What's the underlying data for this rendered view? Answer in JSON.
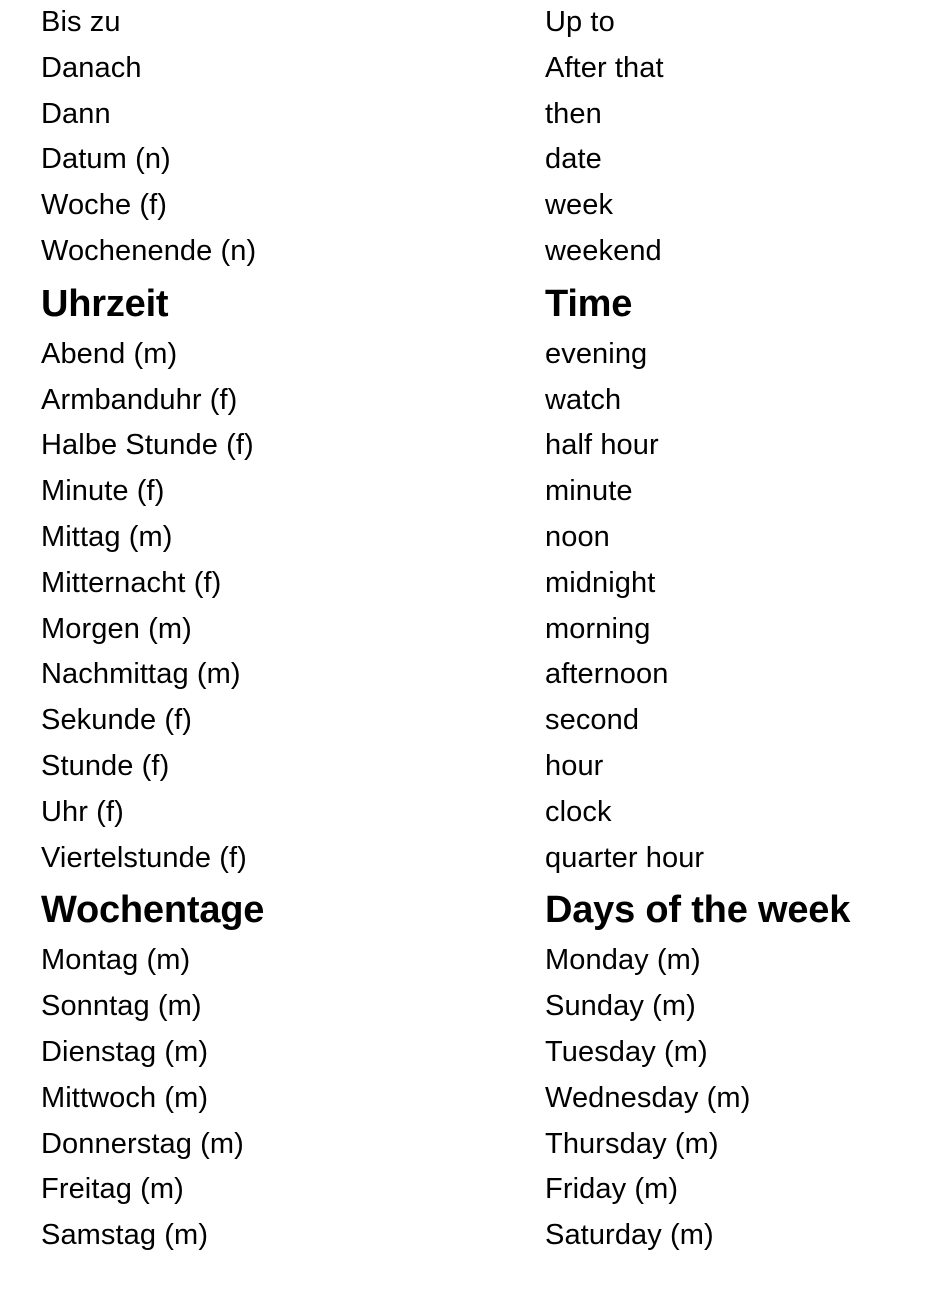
{
  "document": {
    "type": "bilingual-glossary",
    "source_language": "German",
    "target_language": "English",
    "background_color": "#ffffff",
    "text_color": "#000000"
  },
  "rows": [
    {
      "kind": "entry",
      "source": "Bis zu",
      "target": "Up to"
    },
    {
      "kind": "entry",
      "source": "Danach",
      "target": "After that"
    },
    {
      "kind": "entry",
      "source": "Dann",
      "target": "then"
    },
    {
      "kind": "entry",
      "source": "Datum (n)",
      "target": "date"
    },
    {
      "kind": "entry",
      "source": "Woche (f)",
      "target": "week"
    },
    {
      "kind": "entry",
      "source": "Wochenende (n)",
      "target": "weekend"
    },
    {
      "kind": "heading",
      "source": "Uhrzeit",
      "target": "Time"
    },
    {
      "kind": "entry",
      "source": "Abend (m)",
      "target": "evening"
    },
    {
      "kind": "entry",
      "source": "Armbanduhr (f)",
      "target": "watch"
    },
    {
      "kind": "entry",
      "source": "Halbe Stunde (f)",
      "target": "half hour"
    },
    {
      "kind": "entry",
      "source": "Minute (f)",
      "target": "minute"
    },
    {
      "kind": "entry",
      "source": "Mittag (m)",
      "target": "noon"
    },
    {
      "kind": "entry",
      "source": "Mitternacht (f)",
      "target": "midnight"
    },
    {
      "kind": "entry",
      "source": "Morgen (m)",
      "target": "morning"
    },
    {
      "kind": "entry",
      "source": "Nachmittag (m)",
      "target": "afternoon"
    },
    {
      "kind": "entry",
      "source": "Sekunde (f)",
      "target": "second"
    },
    {
      "kind": "entry",
      "source": "Stunde (f)",
      "target": "hour"
    },
    {
      "kind": "entry",
      "source": "Uhr (f)",
      "target": "clock"
    },
    {
      "kind": "entry",
      "source": "Viertelstunde (f)",
      "target": "quarter hour"
    },
    {
      "kind": "heading",
      "source": "Wochentage",
      "target": "Days of the week"
    },
    {
      "kind": "entry",
      "source": "Montag (m)",
      "target": "Monday (m)"
    },
    {
      "kind": "entry",
      "source": "Sonntag (m)",
      "target": "Sunday (m)"
    },
    {
      "kind": "entry",
      "source": "Dienstag (m)",
      "target": "Tuesday (m)"
    },
    {
      "kind": "entry",
      "source": "Mittwoch (m)",
      "target": "Wednesday (m)"
    },
    {
      "kind": "entry",
      "source": "Donnerstag (m)",
      "target": "Thursday (m)"
    },
    {
      "kind": "entry",
      "source": "Freitag (m)",
      "target": "Friday (m)"
    },
    {
      "kind": "entry",
      "source": "Samstag (m)",
      "target": "Saturday (m)"
    }
  ]
}
